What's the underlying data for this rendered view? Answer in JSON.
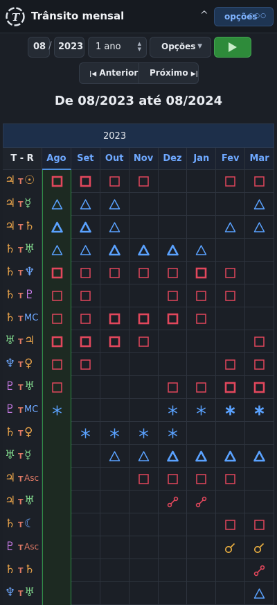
{
  "header": {
    "title": "Trânsito mensal",
    "caret": "^",
    "options_label": "opções",
    "options_dots": "○○○"
  },
  "controls": {
    "month": "08",
    "year": "2023",
    "period": "1 ano",
    "options": "Opções"
  },
  "nav": {
    "prev": "Anterior",
    "next": "Próximo"
  },
  "range_title": "De 08/2023 até 08/2024",
  "table": {
    "year_label": "2023",
    "corner": "T - R",
    "months": [
      "Ago",
      "Set",
      "Out",
      "Nov",
      "Dez",
      "Jan",
      "Fev",
      "Mar"
    ],
    "rows": [
      {
        "t": "♃",
        "tc": "#e8a34a",
        "r": "☉",
        "rc": "#e8a34a",
        "cells": [
          "sq2",
          "sq2",
          "sq",
          "sq",
          "",
          "",
          "sq",
          "sq"
        ]
      },
      {
        "t": "♃",
        "tc": "#e8a34a",
        "r": "☿",
        "rc": "#7fd38a",
        "cells": [
          "tr",
          "tr",
          "tr",
          "",
          "",
          "",
          "",
          "tr"
        ]
      },
      {
        "t": "♃",
        "tc": "#e8a34a",
        "r": "♄",
        "rc": "#e8a34a",
        "cells": [
          "tr2",
          "tr2",
          "tr",
          "",
          "",
          "",
          "tr",
          "tr"
        ]
      },
      {
        "t": "♄",
        "tc": "#e8a34a",
        "r": "♅",
        "rc": "#7fd38a",
        "cells": [
          "tr",
          "tr",
          "tr2",
          "tr2",
          "tr2",
          "tr",
          "",
          ""
        ]
      },
      {
        "t": "♄",
        "tc": "#e8a34a",
        "r": "♆",
        "rc": "#6ea8ff",
        "cells": [
          "sq2",
          "sq",
          "sq",
          "sq",
          "sq",
          "sq2",
          "sq",
          ""
        ]
      },
      {
        "t": "♄",
        "tc": "#e8a34a",
        "r": "♇",
        "rc": "#c77be6",
        "cells": [
          "sq",
          "sq",
          "",
          "",
          "sq",
          "sq",
          "sq",
          ""
        ]
      },
      {
        "t": "♄",
        "tc": "#e8a34a",
        "r": "MC",
        "rc": "#6ea8ff",
        "cells": [
          "sq",
          "sq",
          "sq2",
          "sq2",
          "sq2",
          "sq",
          "",
          ""
        ]
      },
      {
        "t": "♅",
        "tc": "#7fd38a",
        "r": "♃",
        "rc": "#e8a34a",
        "cells": [
          "sq2",
          "sq2",
          "sq2",
          "sq",
          "",
          "",
          "",
          "sq"
        ]
      },
      {
        "t": "♆",
        "tc": "#6ea8ff",
        "r": "♀",
        "rc": "#e8a34a",
        "cells": [
          "sq",
          "sq",
          "",
          "",
          "",
          "",
          "sq",
          "sq"
        ]
      },
      {
        "t": "♇",
        "tc": "#c77be6",
        "r": "♅",
        "rc": "#7fd38a",
        "cells": [
          "sq",
          "",
          "",
          "",
          "sq",
          "sq",
          "sq2",
          "sq2"
        ]
      },
      {
        "t": "♇",
        "tc": "#c77be6",
        "r": "MC",
        "rc": "#6ea8ff",
        "cells": [
          "st",
          "",
          "",
          "",
          "st",
          "st",
          "st2",
          "st2"
        ]
      },
      {
        "t": "♄",
        "tc": "#e8a34a",
        "r": "♀",
        "rc": "#e8a34a",
        "cells": [
          "",
          "st",
          "st",
          "st",
          "st",
          "",
          "",
          ""
        ]
      },
      {
        "t": "♅",
        "tc": "#7fd38a",
        "r": "☿",
        "rc": "#7fd38a",
        "cells": [
          "",
          "",
          "tr",
          "tr",
          "tr2",
          "tr2",
          "tr2",
          "tr2"
        ]
      },
      {
        "t": "♃",
        "tc": "#e8a34a",
        "r": "Asc",
        "rc": "#e07a66",
        "cells": [
          "",
          "",
          "",
          "sq",
          "sq",
          "sq",
          "sq",
          ""
        ]
      },
      {
        "t": "♃",
        "tc": "#e8a34a",
        "r": "♅",
        "rc": "#7fd38a",
        "cells": [
          "",
          "",
          "",
          "",
          "op",
          "op",
          "",
          ""
        ]
      },
      {
        "t": "♄",
        "tc": "#e8a34a",
        "r": "☾",
        "rc": "#6ea8ff",
        "cells": [
          "",
          "",
          "",
          "",
          "",
          "",
          "sq",
          "sq"
        ]
      },
      {
        "t": "♇",
        "tc": "#c77be6",
        "r": "Asc",
        "rc": "#e07a66",
        "cells": [
          "",
          "",
          "",
          "",
          "",
          "",
          "cj",
          "cj"
        ]
      },
      {
        "t": "♄",
        "tc": "#e8a34a",
        "r": "♄",
        "rc": "#e8a34a",
        "cells": [
          "",
          "",
          "",
          "",
          "",
          "",
          "",
          "op"
        ]
      },
      {
        "t": "♆",
        "tc": "#6ea8ff",
        "r": "♅",
        "rc": "#7fd38a",
        "cells": [
          "",
          "",
          "",
          "",
          "",
          "",
          "",
          "tr"
        ]
      }
    ]
  },
  "colors": {
    "square": "#e2475c",
    "trine": "#5aa2ff",
    "sextile": "#5aa2ff",
    "opposition": "#e2475c",
    "conjunction": "#f0b341",
    "current_month": "#2f8f46"
  }
}
